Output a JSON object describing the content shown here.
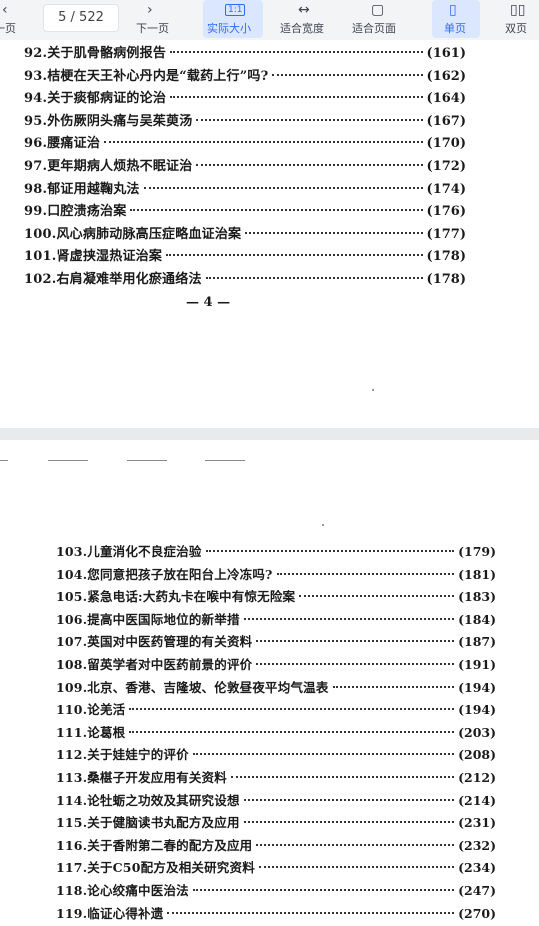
{
  "toolbar": {
    "prev_label": "一页",
    "page_current": "5",
    "page_total": "522",
    "next_label": "下一页",
    "actual_size_label": "实际大小",
    "fit_width_label": "适合宽度",
    "fit_page_label": "适合页面",
    "single_label": "单页",
    "double_label": "双页",
    "accent_color": "#2f6bff"
  },
  "page_upper": {
    "entries": [
      {
        "text": "92.关于肌骨骼病例报告",
        "page": "(161)"
      },
      {
        "text": "93.桔梗在天王补心丹内是“载药上行”吗?",
        "page": "(162)"
      },
      {
        "text": "94.关于痰郁病证的论治",
        "page": "(164)"
      },
      {
        "text": "95.外伤厥阴头痛与吴茱萸汤",
        "page": "(167)"
      },
      {
        "text": "96.腰痛证治",
        "page": "(170)"
      },
      {
        "text": "97.更年期病人烦热不眠证治",
        "page": "(172)"
      },
      {
        "text": "98.郁证用越鞠丸法",
        "page": "(174)"
      },
      {
        "text": "99.口腔溃疡治案",
        "page": "(176)"
      },
      {
        "text": "100.风心病肺动脉高压症略血证治案",
        "page": "(177)"
      },
      {
        "text": "101.肾虚挟湿热证治案",
        "page": "(178)"
      },
      {
        "text": "102.右肩凝难举用化瘀通络法",
        "page": "(178)"
      }
    ],
    "footer": "— 4 —"
  },
  "page_lower": {
    "entries": [
      {
        "text": "103.儿童消化不良症治验",
        "page": "(179)"
      },
      {
        "text": "104.您同意把孩子放在阳台上冷冻吗?",
        "page": "(181)"
      },
      {
        "text": "105.紧急电话:大药丸卡在喉中有惊无险案",
        "page": "(183)"
      },
      {
        "text": "106.提高中医国际地位的新举措",
        "page": "(184)"
      },
      {
        "text": "107.英国对中医药管理的有关资料",
        "page": "(187)"
      },
      {
        "text": "108.留英学者对中医药前景的评价",
        "page": "(191)"
      },
      {
        "text": "109.北京、香港、吉隆坡、伦敦昼夜平均气温表",
        "page": "(194)"
      },
      {
        "text": "110.论羌活",
        "page": "(194)"
      },
      {
        "text": "111.论葛根",
        "page": "(203)"
      },
      {
        "text": "112.关于娃娃宁的评价",
        "page": "(208)"
      },
      {
        "text": "113.桑椹子开发应用有关资料",
        "page": "(212)"
      },
      {
        "text": "114.论牡蛎之功效及其研究设想",
        "page": "(214)"
      },
      {
        "text": "115.关于健脑读书丸配方及应用",
        "page": "(231)"
      },
      {
        "text": "116.关于香附第二春的配方及应用",
        "page": "(232)"
      },
      {
        "text": "117.关于C50配方及相关研究资料",
        "page": "(234)"
      },
      {
        "text": "118.论心绞痛中医治法",
        "page": "(247)"
      },
      {
        "text": "119.临证心得补遗",
        "page": "(270)"
      }
    ]
  }
}
